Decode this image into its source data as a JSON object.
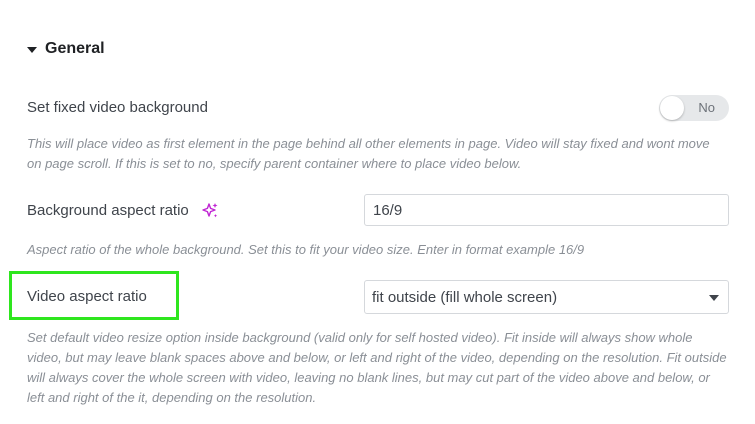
{
  "section": {
    "title": "General"
  },
  "fixed_bg": {
    "label": "Set fixed video background",
    "toggle_value": "No",
    "description": "This will place video as first element in the page behind all other elements in page. Video will stay fixed and wont move on page scroll. If this is set to no, specify parent container where to place video below."
  },
  "bg_aspect": {
    "label": "Background aspect ratio",
    "icon": "ai-sparkle-icon",
    "value": "16/9",
    "description": "Aspect ratio of the whole background. Set this to fit your video size. Enter in format example 16/9"
  },
  "video_aspect": {
    "label": "Video aspect ratio",
    "selected": "fit outside (fill whole screen)",
    "description": "Set default video resize option inside background (valid only for self hosted video). Fit inside will always show whole video, but may leave blank spaces above and below, or left and right of the video, depending on the resolution. Fit outside will always cover the whole screen with video, leaving no blank lines, but may cut part of the video above and below, or left and right of the it, depending on the resolution."
  },
  "colors": {
    "highlight": "#2ee61e",
    "sparkle": "#c026d3"
  }
}
